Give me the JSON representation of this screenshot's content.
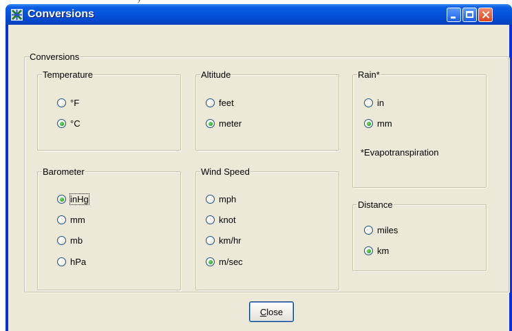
{
  "window": {
    "title": "Conversions",
    "buttons": {
      "minimize": "minimize",
      "maximize": "maximize",
      "close": "close"
    }
  },
  "outer_group": {
    "label": "Conversions"
  },
  "groups": {
    "temperature": {
      "label": "Temperature",
      "options": [
        "°F",
        "°C"
      ],
      "selected": "°C"
    },
    "altitude": {
      "label": "Altitude",
      "options": [
        "feet",
        "meter"
      ],
      "selected": "meter"
    },
    "rain": {
      "label": "Rain*",
      "options": [
        "in",
        "mm"
      ],
      "selected": "mm",
      "note": "*Evapotranspiration"
    },
    "barometer": {
      "label": "Barometer",
      "options": [
        "inHg",
        "mm",
        "mb",
        "hPa"
      ],
      "selected": "inHg"
    },
    "wind_speed": {
      "label": "Wind Speed",
      "options": [
        "mph",
        "knot",
        "km/hr",
        "m/sec"
      ],
      "selected": "m/sec"
    },
    "distance": {
      "label": "Distance",
      "options": [
        "miles",
        "km"
      ],
      "selected": "km"
    }
  },
  "footer": {
    "close_label": "lose",
    "close_mnemonic": "C"
  },
  "colors": {
    "titlebar": "#0553dd",
    "client_bg": "#ece9d8",
    "radio_check": "#21a121"
  }
}
